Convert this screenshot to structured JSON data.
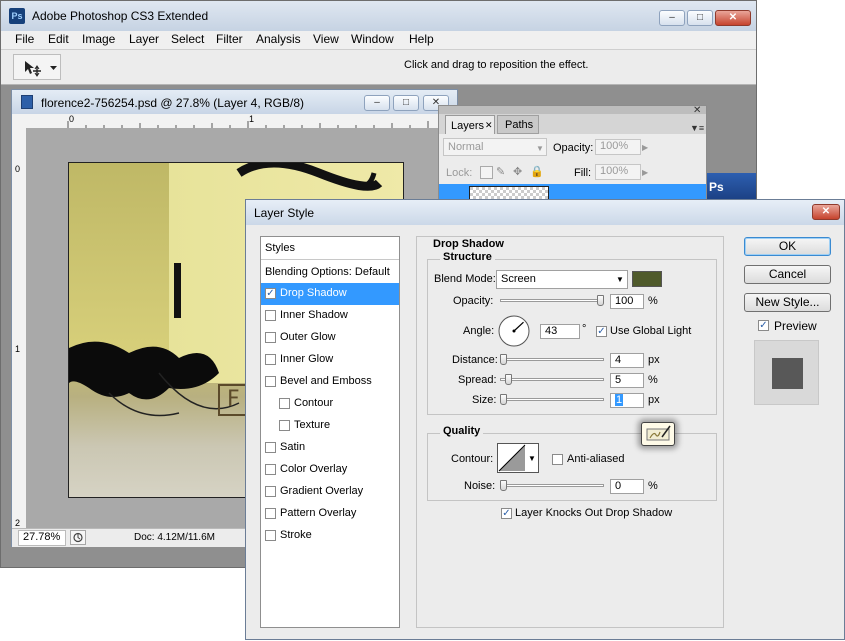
{
  "app": {
    "title": "Adobe Photoshop CS3 Extended",
    "logo_text": "Ps",
    "menu": [
      "File",
      "Edit",
      "Image",
      "Layer",
      "Select",
      "Filter",
      "Analysis",
      "View",
      "Window",
      "Help"
    ],
    "options_hint": "Click and drag to reposition the effect."
  },
  "document": {
    "title": "florence2-756254.psd @ 27.8% (Layer 4, RGB/8)",
    "zoom": "27.78%",
    "doc_size": "Doc: 4.12M/11.6M",
    "ruler_top": [
      "0",
      "1"
    ],
    "ruler_left": [
      "0",
      "1",
      "2"
    ],
    "artwork_letter": "F"
  },
  "layers_panel": {
    "tabs": [
      "Layers",
      "Paths"
    ],
    "blend_mode": "Normal",
    "opacity_label": "Opacity:",
    "opacity_value": "100%",
    "lock_label": "Lock:",
    "fill_label": "Fill:",
    "fill_value": "100%",
    "partial_text": "Ps"
  },
  "dialog": {
    "title": "Layer Style",
    "styles_header": "Styles",
    "blending_options": "Blending Options: Default",
    "style_items": [
      {
        "label": "Drop Shadow",
        "checked": true,
        "selected": true,
        "indent": false
      },
      {
        "label": "Inner Shadow",
        "checked": false,
        "selected": false,
        "indent": false
      },
      {
        "label": "Outer Glow",
        "checked": false,
        "selected": false,
        "indent": false
      },
      {
        "label": "Inner Glow",
        "checked": false,
        "selected": false,
        "indent": false
      },
      {
        "label": "Bevel and Emboss",
        "checked": false,
        "selected": false,
        "indent": false
      },
      {
        "label": "Contour",
        "checked": false,
        "selected": false,
        "indent": true
      },
      {
        "label": "Texture",
        "checked": false,
        "selected": false,
        "indent": true
      },
      {
        "label": "Satin",
        "checked": false,
        "selected": false,
        "indent": false
      },
      {
        "label": "Color Overlay",
        "checked": false,
        "selected": false,
        "indent": false
      },
      {
        "label": "Gradient Overlay",
        "checked": false,
        "selected": false,
        "indent": false
      },
      {
        "label": "Pattern Overlay",
        "checked": false,
        "selected": false,
        "indent": false
      },
      {
        "label": "Stroke",
        "checked": false,
        "selected": false,
        "indent": false
      }
    ],
    "section_title": "Drop Shadow",
    "structure": {
      "legend": "Structure",
      "blend_mode_label": "Blend Mode:",
      "blend_mode_value": "Screen",
      "shadow_color": "#4f5a2b",
      "opacity_label": "Opacity:",
      "opacity_value": "100",
      "opacity_unit": "%",
      "opacity_level": 1.0,
      "angle_label": "Angle:",
      "angle_value": "43",
      "angle_unit": "°",
      "use_global_light": "Use Global Light",
      "use_global_light_checked": true,
      "distance_label": "Distance:",
      "distance_value": "4",
      "distance_unit": "px",
      "distance_level": 0.0,
      "spread_label": "Spread:",
      "spread_value": "5",
      "spread_unit": "%",
      "spread_level": 0.05,
      "size_label": "Size:",
      "size_value": "1",
      "size_unit": "px",
      "size_level": 0.0
    },
    "quality": {
      "legend": "Quality",
      "contour_label": "Contour:",
      "anti_aliased": "Anti-aliased",
      "anti_aliased_checked": false,
      "noise_label": "Noise:",
      "noise_value": "0",
      "noise_unit": "%",
      "noise_level": 0.0
    },
    "knockout_label": "Layer Knocks Out Drop Shadow",
    "knockout_checked": true,
    "buttons": {
      "ok": "OK",
      "cancel": "Cancel",
      "new_style": "New Style..."
    },
    "preview_label": "Preview",
    "preview_checked": true
  },
  "colors": {
    "selection_blue": "#3399ff",
    "shadow_color": "#4f5a2b"
  }
}
